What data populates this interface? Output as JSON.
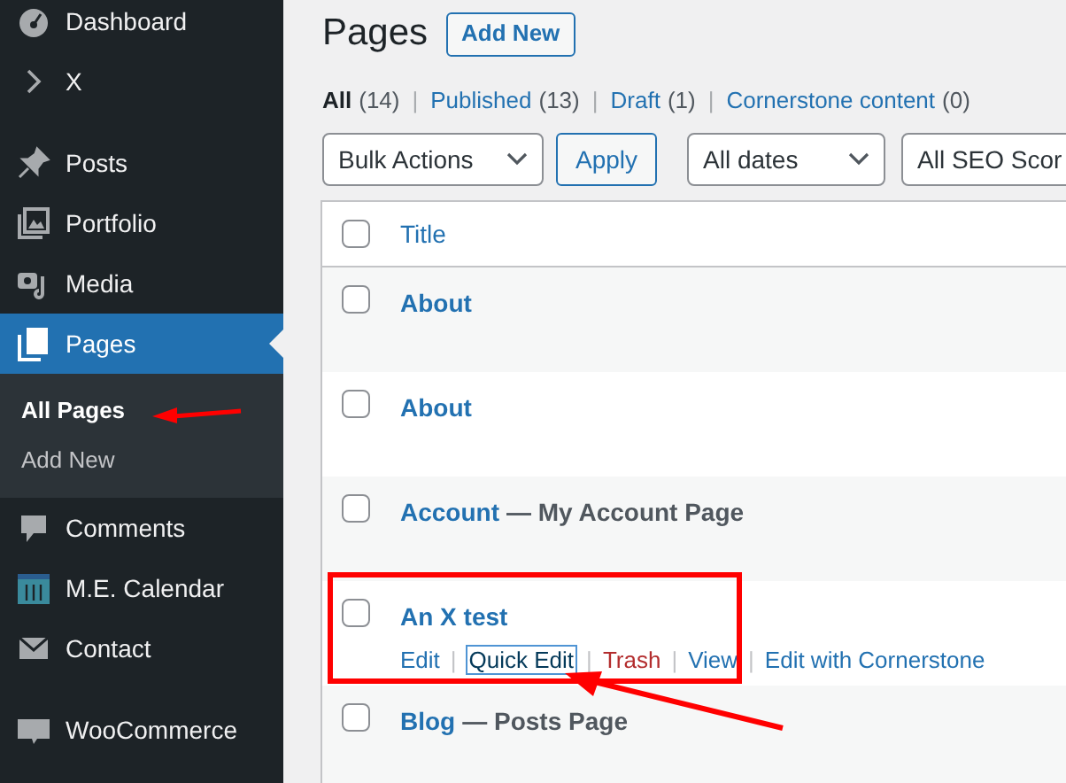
{
  "sidebar": {
    "items": [
      {
        "label": "Dashboard",
        "selected": false
      },
      {
        "label": "X",
        "selected": false
      },
      {
        "label": "Posts",
        "selected": false
      },
      {
        "label": "Portfolio",
        "selected": false
      },
      {
        "label": "Media",
        "selected": false
      },
      {
        "label": "Pages",
        "selected": true,
        "children": [
          {
            "label": "All Pages",
            "selected": true
          },
          {
            "label": "Add New",
            "selected": false
          }
        ]
      },
      {
        "label": "Comments",
        "selected": false
      },
      {
        "label": "M.E. Calendar",
        "selected": false
      },
      {
        "label": "Contact",
        "selected": false
      },
      {
        "label": "WooCommerce",
        "selected": false
      }
    ]
  },
  "header": {
    "title": "Pages",
    "add_button": "Add New"
  },
  "filters": [
    {
      "label": "All",
      "count": "(14)",
      "selected": true
    },
    {
      "label": "Published",
      "count": "(13)",
      "selected": false
    },
    {
      "label": "Draft",
      "count": "(1)",
      "selected": false
    },
    {
      "label": "Cornerstone content",
      "count": "(0)",
      "selected": false
    }
  ],
  "filter_separator": "|",
  "toolbar": {
    "bulk_actions": "Bulk Actions",
    "apply": "Apply",
    "dates": "All dates",
    "seo": "All SEO Scor"
  },
  "table": {
    "column_title": "Title",
    "select_all_checked": false,
    "rows": [
      {
        "title": "About",
        "checked": false
      },
      {
        "title": "About",
        "checked": false
      },
      {
        "title": "Account",
        "suffix": "— My Account Page",
        "checked": false
      },
      {
        "title": "An X test",
        "checked": false,
        "highlighted": true,
        "actions": [
          {
            "label": "Edit",
            "kind": "normal",
            "focused": false
          },
          {
            "label": "Quick Edit",
            "kind": "normal",
            "focused": true
          },
          {
            "label": "Trash",
            "kind": "delete",
            "focused": false
          },
          {
            "label": "View",
            "kind": "normal",
            "focused": false
          },
          {
            "label": "Edit with Cornerstone",
            "kind": "normal",
            "focused": false
          }
        ]
      },
      {
        "title": "Blog",
        "suffix": "— Posts Page",
        "checked": false
      }
    ]
  },
  "action_separator": "|"
}
